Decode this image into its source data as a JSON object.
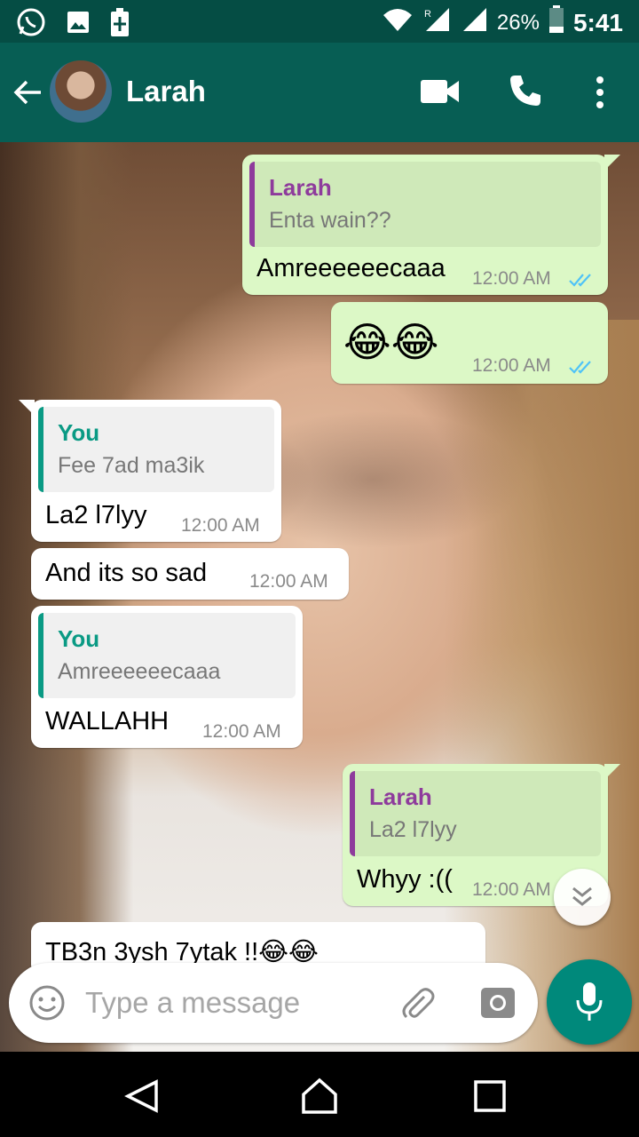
{
  "status_bar": {
    "battery_percent": "26%",
    "time": "5:41"
  },
  "header": {
    "contact_name": "Larah"
  },
  "messages": [
    {
      "direction": "out",
      "quote_name": "Larah",
      "quote_text": "Enta wain??",
      "text": "Amreeeeeecaaa",
      "time": "12:00 AM",
      "status": "read"
    },
    {
      "direction": "out",
      "text": "😂😂",
      "time": "12:00 AM",
      "status": "read"
    },
    {
      "direction": "in",
      "quote_name": "You",
      "quote_text": "Fee 7ad ma3ik",
      "text": "La2 l7lyy",
      "time": "12:00 AM"
    },
    {
      "direction": "in",
      "text": "And its so sad",
      "time": "12:00 AM"
    },
    {
      "direction": "in",
      "quote_name": "You",
      "quote_text": "Amreeeeeecaaa",
      "text": "WALLAHH",
      "time": "12:00 AM"
    },
    {
      "direction": "out",
      "quote_name": "Larah",
      "quote_text": "La2 l7lyy",
      "text": "Whyy :((",
      "time": "12:00 AM",
      "status": "read"
    },
    {
      "direction": "in",
      "text": "TB3n 3ysh 7ytak !!😂😂"
    }
  ],
  "input": {
    "placeholder": "Type a message"
  },
  "colors": {
    "status_bar": "#054d44",
    "app_bar": "#075e54",
    "outgoing_bubble": "#dcf8c6",
    "incoming_bubble": "#ffffff",
    "quote_larah": "#8e3b9c",
    "quote_you": "#0a9a84",
    "read_ticks": "#4fc3f7",
    "mic_button": "#00897b"
  },
  "icons": {
    "status_left": [
      "whatsapp-icon",
      "gallery-icon",
      "battery-saver-icon"
    ],
    "status_right": [
      "wifi-icon",
      "signal-icon",
      "signal-icon",
      "battery-icon"
    ],
    "header": [
      "back-arrow-icon",
      "video-call-icon",
      "phone-icon",
      "more-vert-icon"
    ],
    "input": [
      "emoji-icon",
      "attach-icon",
      "camera-icon",
      "mic-icon"
    ],
    "nav": [
      "nav-back-icon",
      "nav-home-icon",
      "nav-recent-icon"
    ]
  }
}
